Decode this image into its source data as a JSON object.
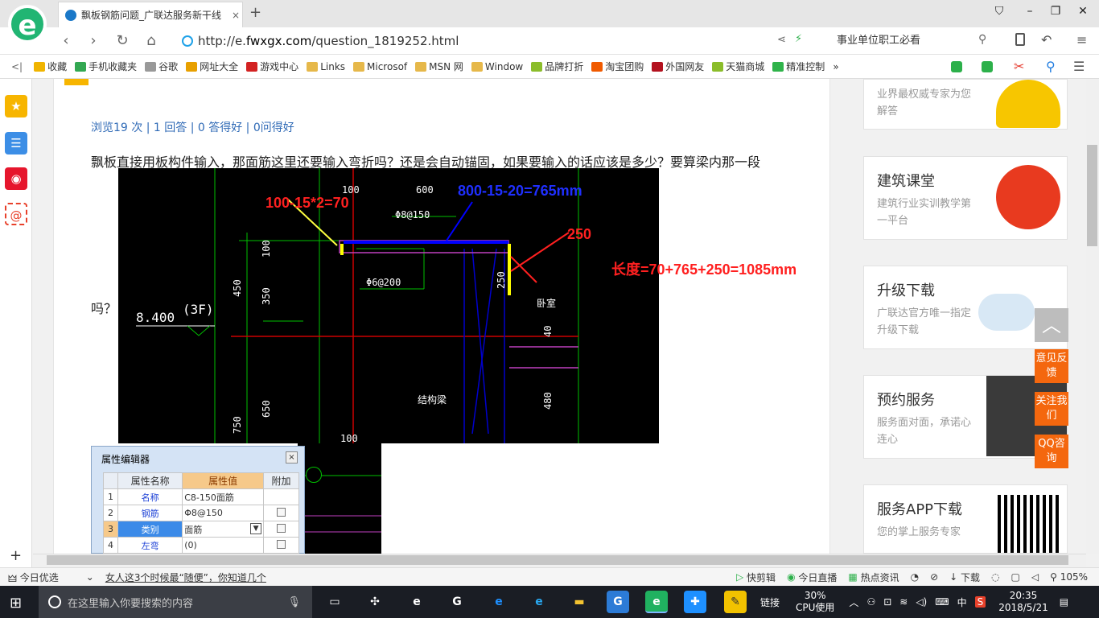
{
  "browser": {
    "tab_title": "飘板钢筋问题_广联达服务新干线",
    "tab_close": "×",
    "new_tab": "+",
    "url_prefix": "http://e.",
    "url_domain": "fwxgx.com",
    "url_path": "/question_1819252.html",
    "search_text": "事业单位职工必看",
    "logo_letter": "e",
    "nav_back": "‹",
    "nav_forward": "›",
    "nav_refresh": "↻",
    "nav_home": "⌂",
    "win_min": "–",
    "win_max": "❐",
    "win_close": "✕"
  },
  "bookmarks": [
    {
      "label": "收藏",
      "color": "#f0b400"
    },
    {
      "label": "手机收藏夹",
      "color": "#33a852"
    },
    {
      "label": "谷歌",
      "color": "#999999"
    },
    {
      "label": "网址大全",
      "color": "#e8a000"
    },
    {
      "label": "游戏中心",
      "color": "#d32222"
    },
    {
      "label": "Links",
      "color": "#e6b84a"
    },
    {
      "label": "Microsof",
      "color": "#e6b84a"
    },
    {
      "label": "MSN 网",
      "color": "#e6b84a"
    },
    {
      "label": "Window",
      "color": "#e6b84a"
    },
    {
      "label": "品牌打折",
      "color": "#8bbd2b"
    },
    {
      "label": "淘宝团购",
      "color": "#f05a00"
    },
    {
      "label": "外国网友",
      "color": "#b3121f"
    },
    {
      "label": "天猫商城",
      "color": "#8bbd2b"
    },
    {
      "label": "精准控制",
      "color": "#2fb34a"
    }
  ],
  "bookmarks_more": "»",
  "question": {
    "stats": "浏览19 次 | 1 回答 | 0 答得好 | 0问得好",
    "text": "飘板直接用板构件输入，那面筋这里还要输入弯折吗？还是会自动锚固，如果要输入的话应该是多少？要算梁内那一段",
    "tail": "吗？"
  },
  "cad": {
    "ann_left": "100-15*2=70",
    "ann_top": "800-15-20=765mm",
    "ann_right": "250",
    "ann_total": "长度=70+765+250=1085mm",
    "dim_600": "600",
    "dim_100_top": "100",
    "rebar_top": "Φ8@150",
    "rebar_mid": "Φ6@200",
    "dim_100": "100",
    "dim_450": "450",
    "dim_350": "350",
    "dim_250": "250",
    "elev": "8.400",
    "floor": "(3F)",
    "dim_750": "750",
    "dim_650": "650",
    "dim_480": "480",
    "dim_40": "40",
    "room": "卧室",
    "beam": "结构梁",
    "dim_100_bot": "100"
  },
  "prop_editor": {
    "title": "属性编辑器",
    "close": "×",
    "headers": [
      "属性名称",
      "属性值",
      "附加"
    ],
    "rows": [
      {
        "num": "1",
        "name": "名称",
        "value": "C8-150面筋"
      },
      {
        "num": "2",
        "name": "钢筋",
        "value": "Φ8@150"
      },
      {
        "num": "3",
        "name": "类别",
        "value": "面筋"
      },
      {
        "num": "4",
        "name": "左弯",
        "value": "(0)"
      }
    ]
  },
  "cards": [
    {
      "title": "",
      "sub": "业界最权威专家为您解答"
    },
    {
      "title": "建筑课堂",
      "sub": "建筑行业实训教学第一平台"
    },
    {
      "title": "升级下载",
      "sub": "广联达官方唯一指定升级下载"
    },
    {
      "title": "预约服务",
      "sub": "服务面对面，承诺心连心"
    },
    {
      "title": "服务APP下载",
      "sub": "您的掌上服务专家"
    }
  ],
  "float_buttons": [
    "意见反馈",
    "关注我们",
    "QQ咨询"
  ],
  "totop": "︿",
  "status_bar": {
    "today": "今日优选",
    "news": "女人这3个时候最“随便”，你知道几个",
    "items": [
      "快剪辑",
      "今日直播",
      "热点资讯",
      "下载"
    ],
    "zoom": "105%"
  },
  "taskbar": {
    "search_placeholder": "在这里输入你要搜索的内容",
    "cpu_pct": "30%",
    "cpu_label": "CPU使用",
    "link": "链接",
    "ime": "中",
    "time": "20:35",
    "date": "2018/5/21"
  }
}
